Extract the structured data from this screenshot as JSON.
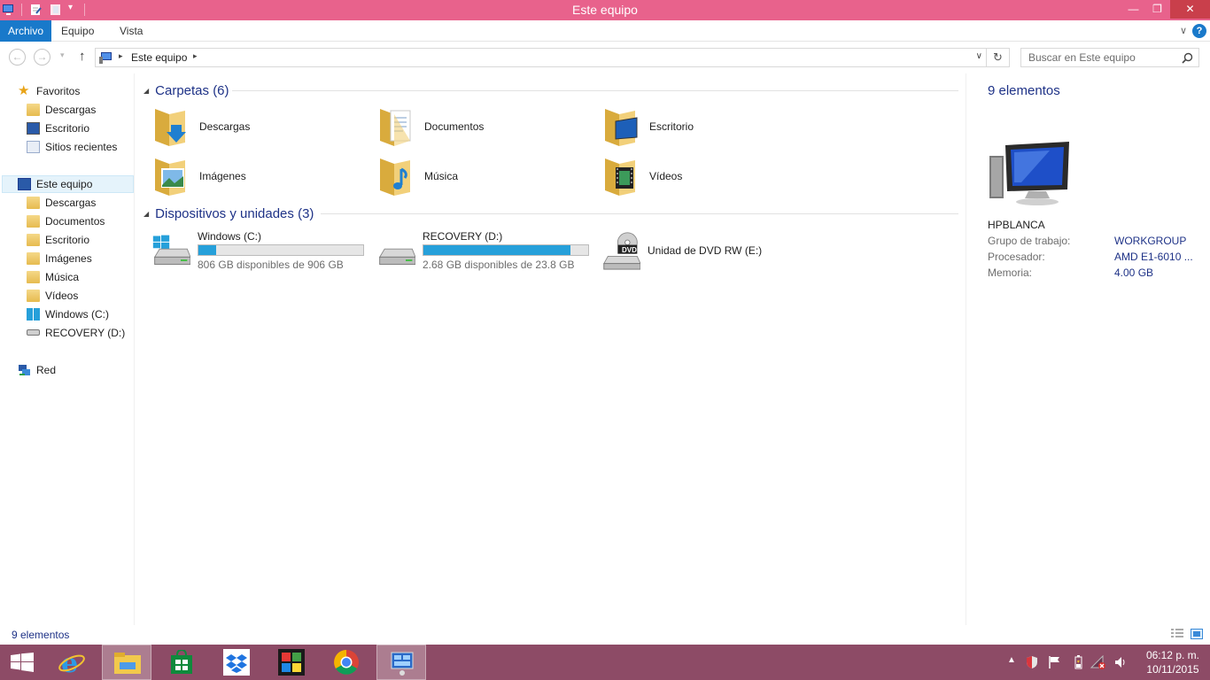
{
  "window": {
    "title": "Este equipo",
    "minimize_glyph": "—",
    "maximize_glyph": "❐",
    "close_glyph": "✕"
  },
  "ribbon": {
    "tabs": [
      {
        "label": "Archivo",
        "active": true
      },
      {
        "label": "Equipo"
      },
      {
        "label": "Vista"
      }
    ],
    "help_glyph": "?"
  },
  "navigation": {
    "back_glyph": "←",
    "forward_glyph": "→",
    "up_glyph": "↑",
    "address_path": "Este equipo",
    "refresh_glyph": "↻",
    "search_placeholder": "Buscar en Este equipo"
  },
  "sidebar": {
    "favorites_label": "Favoritos",
    "favorites": [
      {
        "label": "Descargas"
      },
      {
        "label": "Escritorio"
      },
      {
        "label": "Sitios recientes"
      }
    ],
    "this_pc_label": "Este equipo",
    "this_pc": [
      {
        "label": "Descargas"
      },
      {
        "label": "Documentos"
      },
      {
        "label": "Escritorio"
      },
      {
        "label": "Imágenes"
      },
      {
        "label": "Música"
      },
      {
        "label": "Vídeos"
      },
      {
        "label": "Windows (C:)"
      },
      {
        "label": "RECOVERY (D:)"
      }
    ],
    "network_label": "Red"
  },
  "content": {
    "folders_header": "Carpetas (6)",
    "folders": [
      {
        "name": "Descargas",
        "icon": "downloads-folder-icon"
      },
      {
        "name": "Documentos",
        "icon": "documents-folder-icon"
      },
      {
        "name": "Escritorio",
        "icon": "desktop-folder-icon"
      },
      {
        "name": "Imágenes",
        "icon": "pictures-folder-icon"
      },
      {
        "name": "Música",
        "icon": "music-folder-icon"
      },
      {
        "name": "Vídeos",
        "icon": "videos-folder-icon"
      }
    ],
    "devices_header": "Dispositivos y unidades (3)",
    "drives": [
      {
        "name": "Windows (C:)",
        "space": "806 GB disponibles de 906 GB",
        "used_fraction": 0.11
      },
      {
        "name": "RECOVERY (D:)",
        "space": "2.68 GB disponibles de 23.8 GB",
        "used_fraction": 0.89
      }
    ],
    "dvd": {
      "name": "Unidad de DVD RW (E:)",
      "badge": "DVD"
    }
  },
  "details": {
    "count": "9 elementos",
    "computer_name": "HPBLANCA",
    "rows": [
      {
        "label": "Grupo de trabajo:",
        "value": "WORKGROUP"
      },
      {
        "label": "Procesador:",
        "value": "AMD E1-6010 ..."
      },
      {
        "label": "Memoria:",
        "value": "4.00 GB"
      }
    ]
  },
  "status": {
    "count": "9 elementos"
  },
  "taskbar": {
    "clock_time": "06:12 p. m.",
    "clock_date": "10/11/2015",
    "colors": {
      "taskbar": "#8d4b66",
      "titlebar": "#e8628c",
      "accent": "#1979ca",
      "drive_fill": "#26a0da"
    }
  }
}
